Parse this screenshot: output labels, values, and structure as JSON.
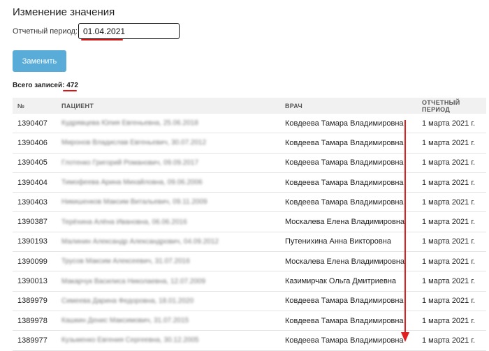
{
  "page": {
    "title": "Изменение значения",
    "period_label": "Отчетный период:",
    "period_value": "01.04.2021",
    "replace_button": "Заменить",
    "total_label": "Всего записей:",
    "total_count": "472"
  },
  "table": {
    "headers": [
      "№",
      "ПАЦИЕНТ",
      "ВРАЧ",
      "ОТЧЕТНЫЙ ПЕРИОД"
    ],
    "rows": [
      {
        "num": "1390407",
        "patient": "Кудрявцева Юлия Евгеньевна, 25.06.2018",
        "doctor": "Ковдеева Тамара Владимировна",
        "period": "1 марта 2021 г."
      },
      {
        "num": "1390406",
        "patient": "Миронов Владислав Евгеньевич, 30.07.2012",
        "doctor": "Ковдеева Тамара Владимировна",
        "period": "1 марта 2021 г."
      },
      {
        "num": "1390405",
        "patient": "Глотенко Григорий Романович, 09.09.2017",
        "doctor": "Ковдеева Тамара Владимировна",
        "period": "1 марта 2021 г."
      },
      {
        "num": "1390404",
        "patient": "Тимофеева Арина Михайловна, 09.06.2006",
        "doctor": "Ковдеева Тамара Владимировна",
        "period": "1 марта 2021 г."
      },
      {
        "num": "1390403",
        "patient": "Никишенков Максим Витальевич, 09.11.2009",
        "doctor": "Ковдеева Тамара Владимировна",
        "period": "1 марта 2021 г."
      },
      {
        "num": "1390387",
        "patient": "Терёхина Алёна Ивановна, 06.06.2016",
        "doctor": "Москалева Елена Владимировна",
        "period": "1 марта 2021 г."
      },
      {
        "num": "1390193",
        "patient": "Малинин Александр Александрович, 04.09.2012",
        "doctor": "Путенихина Анна Викторовна",
        "period": "1 марта 2021 г."
      },
      {
        "num": "1390099",
        "patient": "Трусов Максим Алексеевич, 31.07.2016",
        "doctor": "Москалева Елена Владимировна",
        "period": "1 марта 2021 г."
      },
      {
        "num": "1390013",
        "patient": "Макарчук Василиса Николаевна, 12.07.2009",
        "doctor": "Казимирчак Ольга Дмитриевна",
        "period": "1 марта 2021 г."
      },
      {
        "num": "1389979",
        "patient": "Симеева Дарина Федоровна, 18.01.2020",
        "doctor": "Ковдеева Тамара Владимировна",
        "period": "1 марта 2021 г."
      },
      {
        "num": "1389978",
        "patient": "Кашкин Денис Максимович, 31.07.2015",
        "doctor": "Ковдеева Тамара Владимировна",
        "period": "1 марта 2021 г."
      },
      {
        "num": "1389977",
        "patient": "Кузьменко Евгения Сергеевна, 30.12.2005",
        "doctor": "Ковдеева Тамара Владимировна",
        "period": "1 марта 2021 г."
      }
    ]
  },
  "colors": {
    "button_bg": "#5aacd8",
    "header_bg": "#f1f1f1",
    "annotation_red": "#d11"
  }
}
